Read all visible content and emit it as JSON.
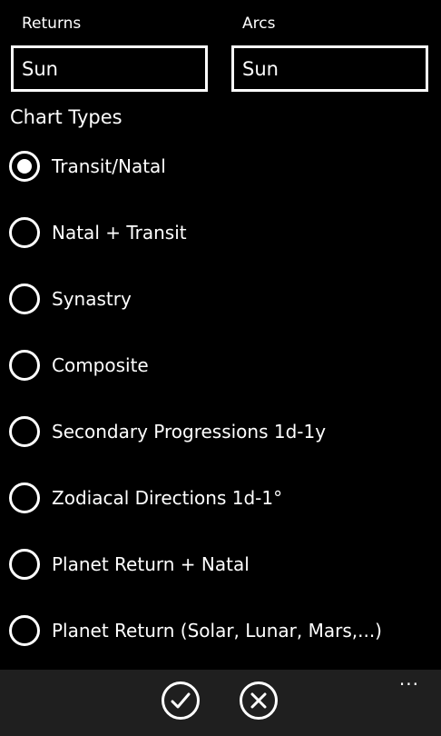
{
  "fields": {
    "returns": {
      "label": "Returns",
      "value": "Sun"
    },
    "arcs": {
      "label": "Arcs",
      "value": "Sun"
    }
  },
  "chart_types": {
    "title": "Chart Types",
    "selected_index": 0,
    "options": [
      "Transit/Natal",
      "Natal + Transit",
      "Synastry",
      "Composite",
      "Secondary Progressions 1d-1y",
      "Zodiacal Directions 1d-1°",
      "Planet Return + Natal",
      "Planet Return (Solar, Lunar, Mars,...)"
    ]
  },
  "appbar": {
    "confirm_icon": "check-icon",
    "cancel_icon": "close-icon",
    "more_icon": "more-icon",
    "more_glyph": "..."
  },
  "colors": {
    "background": "#000000",
    "foreground": "#ffffff",
    "appbar": "#1f1f1f"
  }
}
